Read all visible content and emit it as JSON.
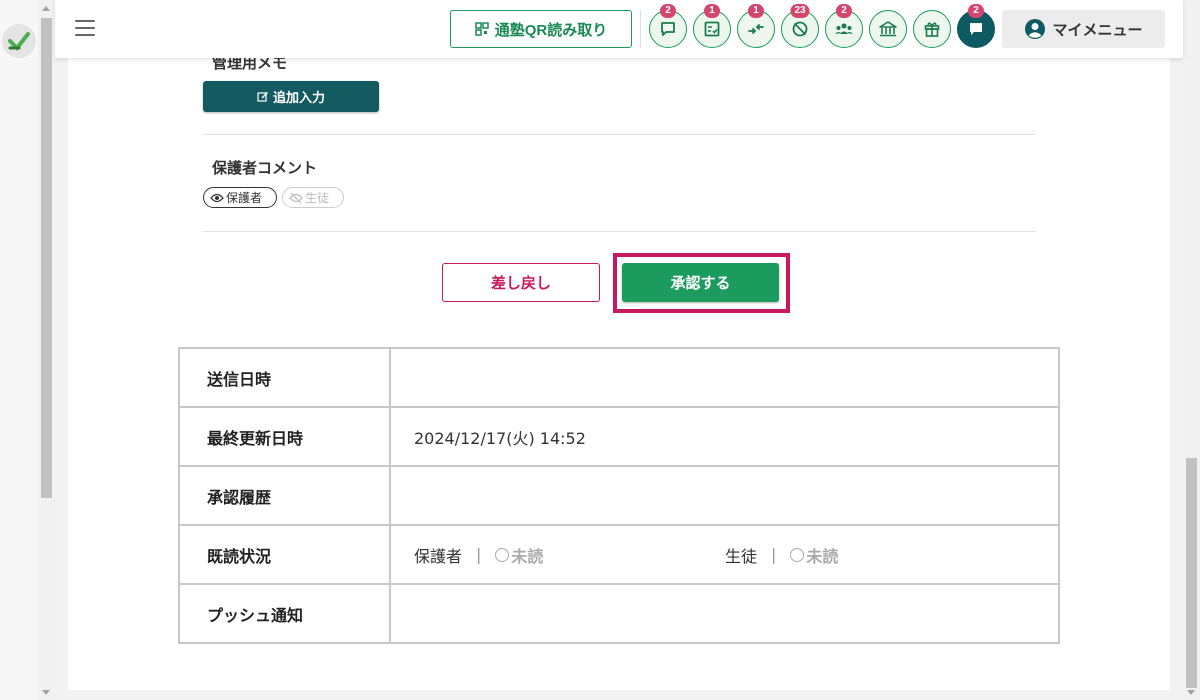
{
  "header": {
    "qr_label": "通塾QR読み取り",
    "icons": [
      {
        "name": "chat-icon",
        "badge": "2"
      },
      {
        "name": "checklist-icon",
        "badge": "1"
      },
      {
        "name": "arrows-in-icon",
        "badge": "1"
      },
      {
        "name": "no-face-icon",
        "badge": "23"
      },
      {
        "name": "group-icon",
        "badge": "2"
      },
      {
        "name": "bank-icon",
        "badge": ""
      },
      {
        "name": "gift-icon",
        "badge": ""
      },
      {
        "name": "message-icon",
        "badge": "2"
      }
    ],
    "menu_label": "マイメニュー"
  },
  "memo": {
    "title": "管理用メモ",
    "add_label": "追加入力"
  },
  "comment": {
    "title": "保護者コメント",
    "tag_parent": "保護者",
    "tag_student": "生徒"
  },
  "actions": {
    "reject_label": "差し戻し",
    "approve_label": "承認する"
  },
  "table": {
    "send_time_label": "送信日時",
    "send_time_value": "",
    "updated_label": "最終更新日時",
    "updated_value": "2024/12/17(火) 14:52",
    "history_label": "承認履歴",
    "history_value": "",
    "read_label": "既読状況",
    "read_parent_label": "保護者",
    "read_parent_status": "未読",
    "read_student_label": "生徒",
    "read_student_status": "未読",
    "push_label": "プッシュ通知",
    "push_value": "",
    "separator": "|"
  },
  "colors": {
    "accent_green": "#1b9b5e",
    "dark_teal": "#145a61",
    "reject_pink": "#c8195e",
    "badge_pink": "#d4466e"
  }
}
